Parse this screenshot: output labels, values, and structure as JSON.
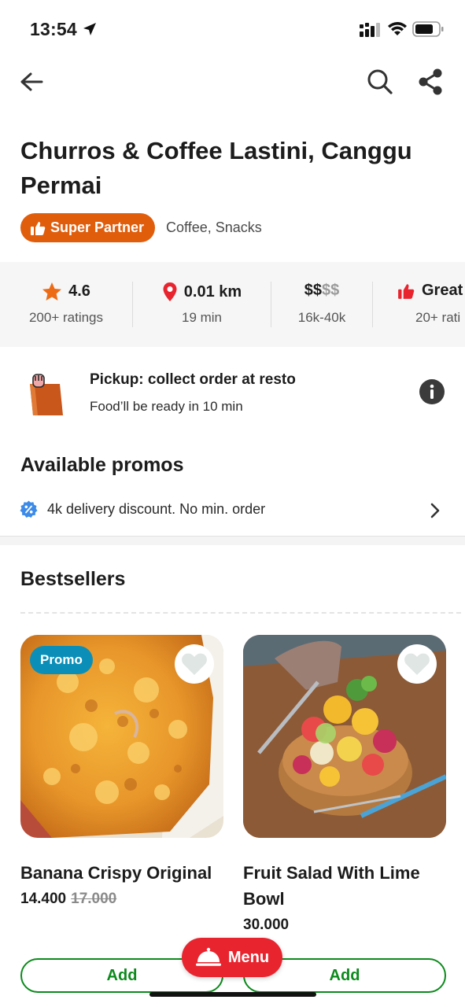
{
  "status_bar": {
    "time": "13:54"
  },
  "restaurant": {
    "name": "Churros & Coffee Lastini, Canggu Permai",
    "badge": "Super Partner",
    "cuisines": "Coffee, Snacks"
  },
  "stats": {
    "rating": {
      "value": "4.6",
      "sub": "200+ ratings"
    },
    "distance": {
      "value": "0.01 km",
      "sub": "19 min"
    },
    "price": {
      "active": "$$",
      "inactive": "$$",
      "sub": "16k-40k"
    },
    "review": {
      "value": "Great",
      "sub": "20+ rati"
    }
  },
  "pickup": {
    "title": "Pickup: collect order at resto",
    "subtitle": "Food’ll be ready in 10 min"
  },
  "promos": {
    "title": "Available promos",
    "items": [
      "4k delivery discount. No min. order"
    ]
  },
  "bestsellers": {
    "title": "Bestsellers",
    "items": [
      {
        "name": "Banana Crispy Original",
        "price": "14.400",
        "old_price": "17.000",
        "tag": "Promo",
        "add_label": "Add"
      },
      {
        "name": "Fruit Salad With Lime Bowl",
        "price": "30.000",
        "old_price": "",
        "tag": "",
        "add_label": "Add"
      }
    ]
  },
  "menu_button": "Menu",
  "colors": {
    "brand_orange": "#e05d0c",
    "promo_blue": "#0b8fb8",
    "add_green": "#0c8a1c",
    "menu_red": "#e8252f"
  },
  "icons": [
    "back-arrow-icon",
    "search-icon",
    "share-icon",
    "thumbs-up-icon",
    "star-icon",
    "location-pin-icon",
    "bag-icon",
    "info-icon",
    "discount-icon",
    "chevron-right-icon",
    "heart-icon",
    "cloche-icon"
  ]
}
